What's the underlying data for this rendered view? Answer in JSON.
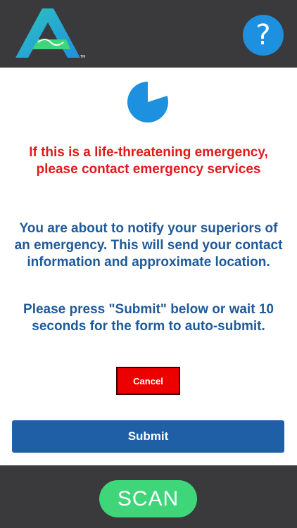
{
  "header": {
    "logo_icon": "handshake-a-logo-icon",
    "help_icon": "question-mark-icon",
    "help_label": "?"
  },
  "timer": {
    "icon": "countdown-pie-icon",
    "color": "#1e90e0",
    "remaining_fraction": 0.8
  },
  "warning_text": "If this is a life-threatening emergency, please contact emergency services",
  "info_text": "You are about to notify your superiors of an emergency. This will send your contact information and approximate location.",
  "instruction_text": "Please press \"Submit\" below or wait 10 seconds for the form to auto-submit.",
  "buttons": {
    "cancel_label": "Cancel",
    "submit_label": "Submit",
    "scan_label": "SCAN"
  },
  "colors": {
    "warning": "#e01b1b",
    "info": "#1f5a9a",
    "cancel": "#ee0000",
    "submit": "#1f5fa6",
    "scan": "#3fd67a",
    "bars": "#3a3a3c"
  }
}
